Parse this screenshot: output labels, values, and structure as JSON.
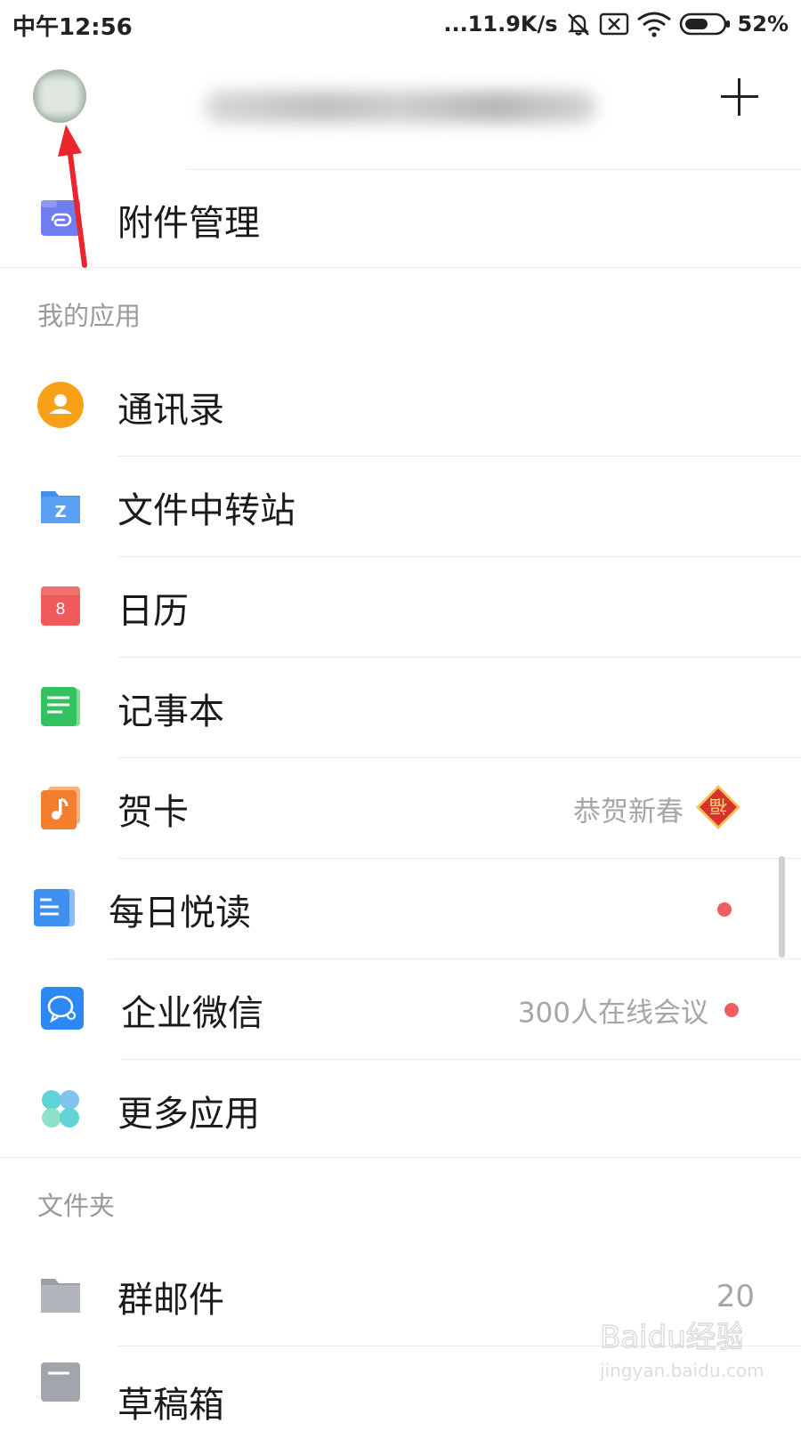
{
  "status_bar": {
    "time": "中午12:56",
    "network_speed": "...11.9K/s",
    "battery_percent": "52%",
    "icons": [
      "mute-icon",
      "sim-off-icon",
      "wifi-icon",
      "battery-icon"
    ]
  },
  "header": {
    "avatar_icon": "avatar",
    "add_icon": "plus-icon"
  },
  "attachment": {
    "label": "附件管理",
    "icon": "attachment-icon",
    "color": "#6f7df1"
  },
  "apps_section": {
    "title": "我的应用",
    "items": [
      {
        "label": "通讯录",
        "icon": "contacts-icon",
        "color": "#f8a117"
      },
      {
        "label": "文件中转站",
        "icon": "file-transfer-icon",
        "color": "#3e8ff0"
      },
      {
        "label": "日历",
        "icon": "calendar-icon",
        "color": "#ef5a5a",
        "icon_text": "8"
      },
      {
        "label": "记事本",
        "icon": "notepad-icon",
        "color": "#33c25f"
      },
      {
        "label": "贺卡",
        "icon": "greeting-card-icon",
        "color": "#f47e2e",
        "hint": "恭贺新春",
        "badge_icon": "fu-badge-icon"
      },
      {
        "label": "每日悦读",
        "icon": "daily-reading-icon",
        "color": "#3e8ff0",
        "has_dot": true
      },
      {
        "label": "企业微信",
        "icon": "wecom-icon",
        "color": "#2b88f4",
        "hint": "300人在线会议",
        "has_dot": true
      },
      {
        "label": "更多应用",
        "icon": "more-apps-icon",
        "color": "#5fd3d6"
      }
    ]
  },
  "folders_section": {
    "title": "文件夹",
    "items": [
      {
        "label": "群邮件",
        "icon": "folder-icon",
        "count": "20"
      },
      {
        "label": "草稿箱",
        "icon": "drafts-icon"
      }
    ]
  },
  "watermark": {
    "logo_text": "Baidu经验",
    "sub_text": "jingyan.baidu.com"
  },
  "colors": {
    "dot_red": "#ef5e60",
    "annotation_red": "#e8262b",
    "hint_gray": "#a6a6a6",
    "section_gray": "#9a9a9a"
  }
}
